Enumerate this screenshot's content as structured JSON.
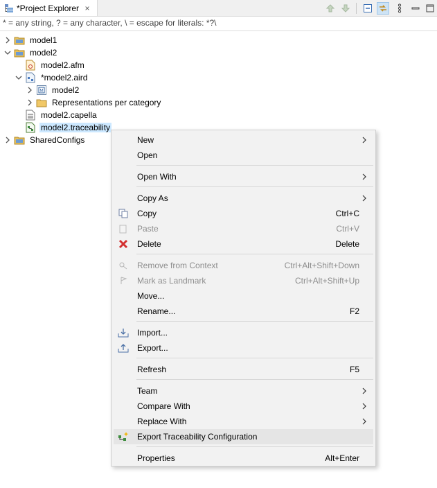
{
  "view": {
    "tab_title": "*Project Explorer",
    "close_glyph": "×",
    "toolbar_icons": [
      "arrow-up-icon",
      "arrow-down-icon",
      "collapse-all-icon",
      "link-with-editor-icon",
      "view-menu-icon",
      "minimize-icon",
      "maximize-icon"
    ]
  },
  "filter": {
    "placeholder": "* = any string, ? = any character, \\ = escape for literals: *?\\"
  },
  "tree": {
    "model1": "model1",
    "model2": "model2",
    "model2_afm": "model2.afm",
    "model2_aird": "*model2.aird",
    "aird_model2": "model2",
    "representations": "Representations per category",
    "model2_capella": "model2.capella",
    "model2_traceability": "model2.traceability",
    "sharedconfigs": "SharedConfigs"
  },
  "menu": {
    "new": "New",
    "open": "Open",
    "open_with": "Open With",
    "copy_as": "Copy As",
    "copy": "Copy",
    "copy_accel": "Ctrl+C",
    "paste": "Paste",
    "paste_accel": "Ctrl+V",
    "delete": "Delete",
    "delete_accel": "Delete",
    "remove_from_context": "Remove from Context",
    "remove_accel": "Ctrl+Alt+Shift+Down",
    "mark_as_landmark": "Mark as Landmark",
    "mark_accel": "Ctrl+Alt+Shift+Up",
    "move": "Move...",
    "rename": "Rename...",
    "rename_accel": "F2",
    "import": "Import...",
    "export": "Export...",
    "refresh": "Refresh",
    "refresh_accel": "F5",
    "team": "Team",
    "compare_with": "Compare With",
    "replace_with": "Replace With",
    "export_traceability": "Export Traceability Configuration",
    "properties": "Properties",
    "properties_accel": "Alt+Enter"
  },
  "colors": {
    "selection": "#cce8ff",
    "menu_bg": "#f2f2f2",
    "menu_hover": "#e5e5e5",
    "disabled_text": "#8d8d8d",
    "delete_red": "#d32f2f"
  }
}
